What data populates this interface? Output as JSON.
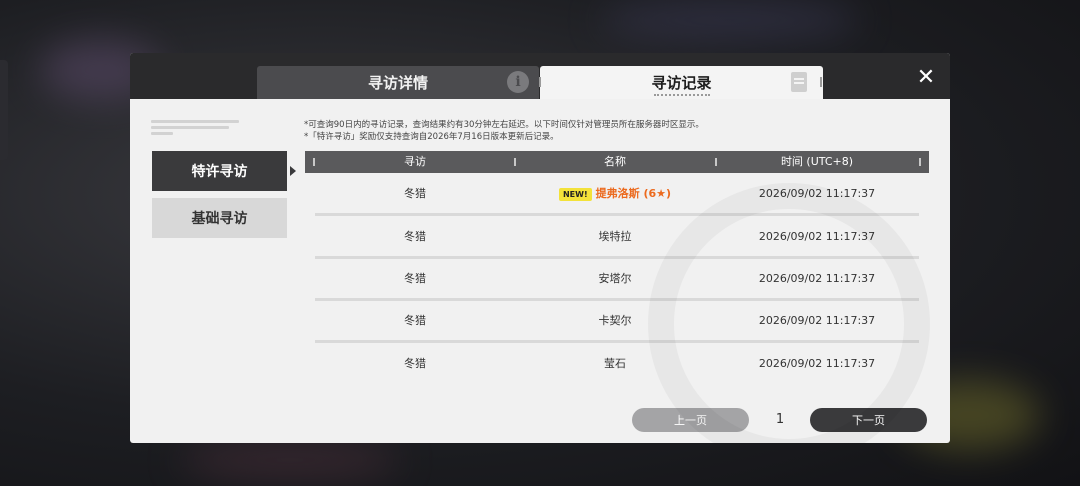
{
  "dialog": {
    "tabs": [
      {
        "label": "寻访详情",
        "info_icon": "info-icon"
      },
      {
        "label": "寻访记录",
        "doc_icon": "document-icon"
      }
    ],
    "close_icon": "close-icon"
  },
  "sidebar": {
    "items": [
      {
        "label": "特许寻访",
        "active": true
      },
      {
        "label": "基础寻访",
        "active": false
      }
    ]
  },
  "notes": [
    "*可查询90日内的寻访记录，查询结果约有30分钟左右延迟。以下时间仅针对管理员所在服务器时区显示。",
    "*「特许寻访」奖励仅支持查询自2026年7月16日版本更新后记录。"
  ],
  "table": {
    "headers": [
      "寻访",
      "名称",
      "时间 (UTC+8)"
    ],
    "rows": [
      {
        "pool": "冬猎",
        "name": "提弗洛斯 (6★)",
        "time": "2026/09/02 11:17:37",
        "new": true
      },
      {
        "pool": "冬猎",
        "name": "埃特拉",
        "time": "2026/09/02 11:17:37",
        "new": false
      },
      {
        "pool": "冬猎",
        "name": "安塔尔",
        "time": "2026/09/02 11:17:37",
        "new": false
      },
      {
        "pool": "冬猎",
        "name": "卡契尔",
        "time": "2026/09/02 11:17:37",
        "new": false
      },
      {
        "pool": "冬猎",
        "name": "莹石",
        "time": "2026/09/02 11:17:37",
        "new": false
      }
    ],
    "new_badge": "NEW!"
  },
  "pager": {
    "prev_label": "上一页",
    "page": "1",
    "next_label": "下一页"
  },
  "colors": {
    "highlight_name": "#ec6a1e",
    "new_badge": "#f3e23a",
    "dark": "#3a3a3c"
  }
}
